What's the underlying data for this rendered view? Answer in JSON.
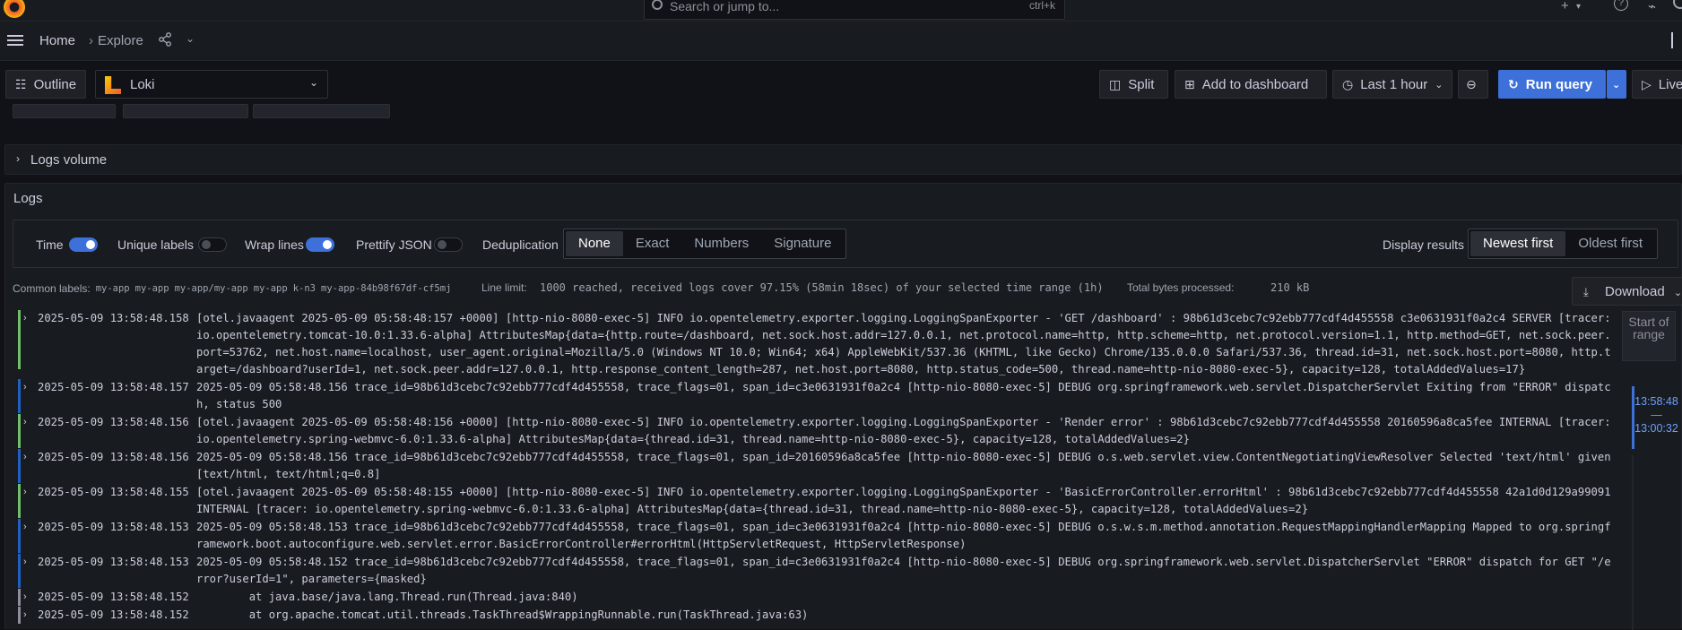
{
  "topbar": {
    "search_placeholder": "Search or jump to...",
    "search_shortcut": "ctrl+k",
    "plus_label": "+",
    "help_label": "?",
    "rss_label": "⌁"
  },
  "breadcrumb": {
    "home": "Home",
    "separator": "›",
    "explore": "Explore"
  },
  "toolbar": {
    "outline": "Outline",
    "datasource": "Loki",
    "split": "Split",
    "add_to_dashboard": "Add to dashboard",
    "time_range": "Last 1 hour",
    "run_query": "Run query",
    "live": "Live"
  },
  "logs_volume": {
    "title": "Logs volume"
  },
  "logs": {
    "title": "Logs",
    "options": {
      "time": "Time",
      "unique_labels": "Unique labels",
      "wrap_lines": "Wrap lines",
      "prettify_json": "Prettify JSON",
      "deduplication": "Deduplication",
      "dedup_options": [
        "None",
        "Exact",
        "Numbers",
        "Signature"
      ],
      "dedup_selected": "None",
      "display_results": "Display results",
      "order_options": [
        "Newest first",
        "Oldest first"
      ],
      "order_selected": "Newest first"
    },
    "common_labels_label": "Common labels:",
    "common_labels": [
      "my-app",
      "my-app",
      "my-app/my-app",
      "my-app",
      "k-n3",
      "my-app-84b98f67df-cf5mj"
    ],
    "line_limit_label": "Line limit:",
    "line_limit_value": "1000 reached, received logs cover 97.15% (58min 18sec) of your selected time range (1h)",
    "total_bytes_label": "Total bytes processed:",
    "total_bytes_value": "210 kB",
    "download": "Download",
    "range_start": "Start of range",
    "range_from": "13:58:48",
    "range_dash": "—",
    "range_to": "13:00:32",
    "rows": [
      {
        "level": "info",
        "ts": "2025-05-09 13:58:48.158",
        "msg": "[otel.javaagent 2025-05-09 05:58:48:157 +0000] [http-nio-8080-exec-5] INFO io.opentelemetry.exporter.logging.LoggingSpanExporter - 'GET /dashboard' : 98b61d3cebc7c92ebb777cdf4d455558 c3e0631931f0a2c4 SERVER [tracer: io.opentelemetry.tomcat-10.0:1.33.6-alpha] AttributesMap{data={http.route=/dashboard, net.sock.host.addr=127.0.0.1, net.protocol.name=http, http.scheme=http, net.protocol.version=1.1, http.method=GET, net.sock.peer.port=53762, net.host.name=localhost, user_agent.original=Mozilla/5.0 (Windows NT 10.0; Win64; x64) AppleWebKit/537.36 (KHTML, like Gecko) Chrome/135.0.0.0 Safari/537.36, thread.id=31, net.sock.host.port=8080, http.target=/dashboard?userId=1, net.sock.peer.addr=127.0.0.1, http.response_content_length=287, net.host.port=8080, http.status_code=500, thread.name=http-nio-8080-exec-5}, capacity=128, totalAddedValues=17}"
      },
      {
        "level": "debug",
        "ts": "2025-05-09 13:58:48.157",
        "msg": "2025-05-09 05:58:48.156 trace_id=98b61d3cebc7c92ebb777cdf4d455558, trace_flags=01, span_id=c3e0631931f0a2c4 [http-nio-8080-exec-5] DEBUG org.springframework.web.servlet.DispatcherServlet Exiting from \"ERROR\" dispatch, status 500"
      },
      {
        "level": "info",
        "ts": "2025-05-09 13:58:48.156",
        "msg": "[otel.javaagent 2025-05-09 05:58:48:156 +0000] [http-nio-8080-exec-5] INFO io.opentelemetry.exporter.logging.LoggingSpanExporter - 'Render error' : 98b61d3cebc7c92ebb777cdf4d455558 20160596a8ca5fee INTERNAL [tracer: io.opentelemetry.spring-webmvc-6.0:1.33.6-alpha] AttributesMap{data={thread.id=31, thread.name=http-nio-8080-exec-5}, capacity=128, totalAddedValues=2}"
      },
      {
        "level": "debug",
        "ts": "2025-05-09 13:58:48.156",
        "msg": "2025-05-09 05:58:48.156 trace_id=98b61d3cebc7c92ebb777cdf4d455558, trace_flags=01, span_id=20160596a8ca5fee [http-nio-8080-exec-5] DEBUG o.s.web.servlet.view.ContentNegotiatingViewResolver Selected 'text/html' given [text/html, text/html;q=0.8]"
      },
      {
        "level": "info",
        "ts": "2025-05-09 13:58:48.155",
        "msg": "[otel.javaagent 2025-05-09 05:58:48:155 +0000] [http-nio-8080-exec-5] INFO io.opentelemetry.exporter.logging.LoggingSpanExporter - 'BasicErrorController.errorHtml' : 98b61d3cebc7c92ebb777cdf4d455558 42a1d0d129a99091 INTERNAL [tracer: io.opentelemetry.spring-webmvc-6.0:1.33.6-alpha] AttributesMap{data={thread.id=31, thread.name=http-nio-8080-exec-5}, capacity=128, totalAddedValues=2}"
      },
      {
        "level": "debug",
        "ts": "2025-05-09 13:58:48.153",
        "msg": "2025-05-09 05:58:48.153 trace_id=98b61d3cebc7c92ebb777cdf4d455558, trace_flags=01, span_id=c3e0631931f0a2c4 [http-nio-8080-exec-5] DEBUG o.s.w.s.m.method.annotation.RequestMappingHandlerMapping Mapped to org.springframework.boot.autoconfigure.web.servlet.error.BasicErrorController#errorHtml(HttpServletRequest, HttpServletResponse)"
      },
      {
        "level": "debug",
        "ts": "2025-05-09 13:58:48.153",
        "msg": "2025-05-09 05:58:48.152 trace_id=98b61d3cebc7c92ebb777cdf4d455558, trace_flags=01, span_id=c3e0631931f0a2c4 [http-nio-8080-exec-5] DEBUG org.springframework.web.servlet.DispatcherServlet \"ERROR\" dispatch for GET \"/error?userId=1\", parameters={masked}"
      },
      {
        "level": "unknown",
        "ts": "2025-05-09 13:58:48.152",
        "msg": "        at java.base/java.lang.Thread.run(Thread.java:840)"
      },
      {
        "level": "unknown",
        "ts": "2025-05-09 13:58:48.152",
        "msg": "        at org.apache.tomcat.util.threads.TaskThread$WrappingRunnable.run(TaskThread.java:63)"
      }
    ]
  }
}
